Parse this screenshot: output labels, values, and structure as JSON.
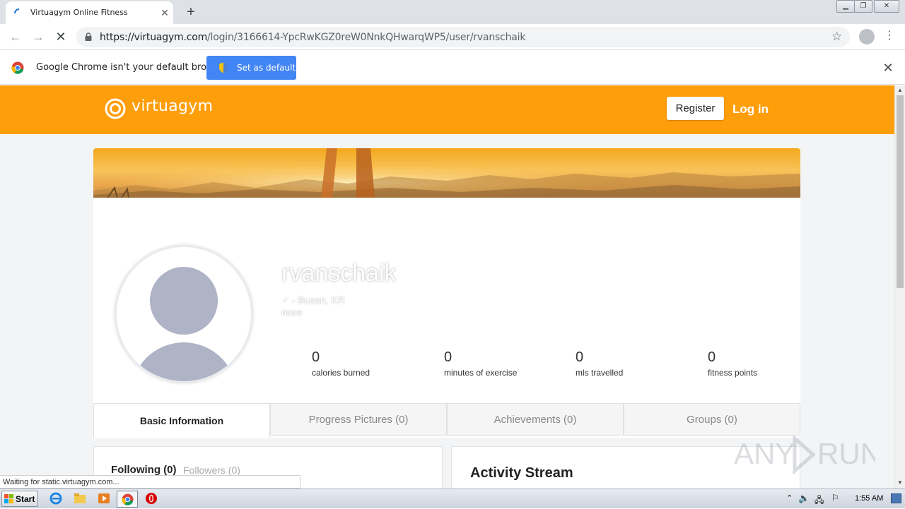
{
  "browser": {
    "tab_title": "Virtuagym Online Fitness",
    "new_tab": "+",
    "url_host": "https://virtuagym.com",
    "url_path": "/login/3166614-YpcRwKGZ0reW0NnkQHwarqWP5/user/rvanschaik",
    "infobar_text": "Google Chrome isn't your default browser",
    "infobar_button": "Set as default",
    "status_text": "Waiting for static.virtuagym.com..."
  },
  "site": {
    "logo_text": "virtuagym",
    "register_label": "Register",
    "login_label": "Log in",
    "brand_color": "#ff9e0b"
  },
  "profile": {
    "username": "rvanschaik",
    "location": "♂ - Busan, KR",
    "more_label": "more",
    "stats": [
      {
        "value": "0",
        "label": "calories burned"
      },
      {
        "value": "0",
        "label": "minutes of exercise"
      },
      {
        "value": "0",
        "label": "mls travelled"
      },
      {
        "value": "0",
        "label": "fitness points"
      }
    ],
    "tabs": [
      {
        "label": "Basic Information"
      },
      {
        "label": "Progress Pictures (0)"
      },
      {
        "label": "Achievements (0)"
      },
      {
        "label": "Groups (0)"
      }
    ],
    "following_label": "Following (0)",
    "followers_label": "Followers (0)",
    "activity_title": "Activity Stream"
  },
  "taskbar": {
    "start_label": "Start",
    "clock": "1:55 AM"
  }
}
